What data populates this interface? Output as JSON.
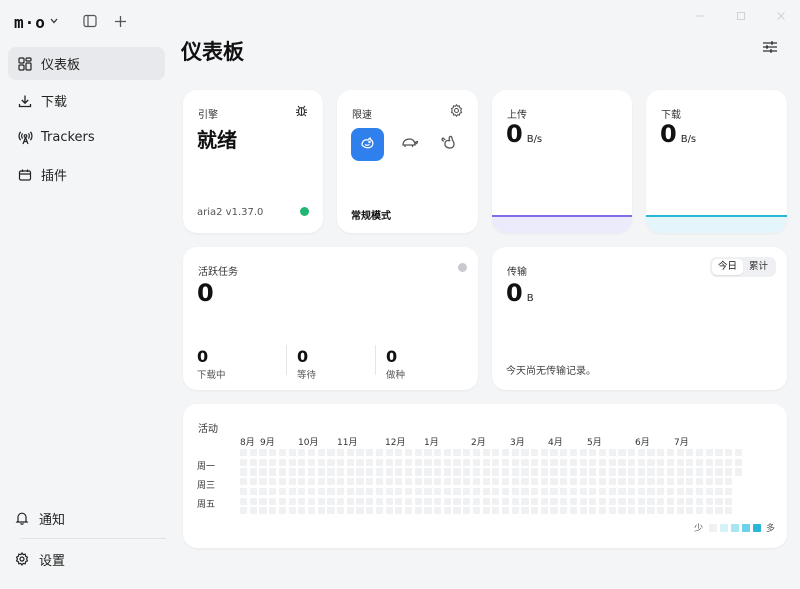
{
  "brand": {
    "logo": "m·o"
  },
  "sidebar": {
    "items": [
      {
        "label": "仪表板",
        "icon": "dashboard-icon",
        "active": true
      },
      {
        "label": "下载",
        "icon": "download-icon",
        "active": false
      },
      {
        "label": "Trackers",
        "icon": "trackers-icon",
        "active": false
      },
      {
        "label": "插件",
        "icon": "plugins-icon",
        "active": false
      }
    ],
    "bottom": [
      {
        "label": "通知",
        "icon": "bell-icon"
      },
      {
        "label": "设置",
        "icon": "gear-icon"
      }
    ]
  },
  "page": {
    "title": "仪表板"
  },
  "engine": {
    "label": "引擎",
    "status": "就绪",
    "version": "aria2 v1.37.0",
    "status_color": "#22b573"
  },
  "speed_limit": {
    "label": "限速",
    "mode": "常规模式",
    "accent": "#2f80ed"
  },
  "upload": {
    "label": "上传",
    "value": "0",
    "unit": "B/s",
    "color": "#7c6ee6"
  },
  "download": {
    "label": "下载",
    "value": "0",
    "unit": "B/s",
    "color": "#27b8d8"
  },
  "active_tasks": {
    "label": "活跃任务",
    "value": "0",
    "stats": [
      {
        "value": "0",
        "label": "下载中"
      },
      {
        "value": "0",
        "label": "等待"
      },
      {
        "value": "0",
        "label": "做种"
      }
    ]
  },
  "transfer": {
    "label": "传输",
    "value": "0",
    "unit": "B",
    "empty": "今天尚无传输记录。",
    "tabs": [
      {
        "label": "今日",
        "active": true
      },
      {
        "label": "累计",
        "active": false
      }
    ]
  },
  "activity": {
    "label": "活动",
    "months": [
      "8月",
      "9月",
      "10月",
      "11月",
      "12月",
      "1月",
      "2月",
      "3月",
      "4月",
      "5月",
      "6月",
      "7月"
    ],
    "days": [
      "周一",
      "周三",
      "周五"
    ],
    "legend_less": "少",
    "legend_more": "多",
    "colors": [
      "#f0f1f3",
      "#d6f1f8",
      "#a9e4f2",
      "#6dd0ea",
      "#2bb5db"
    ]
  }
}
